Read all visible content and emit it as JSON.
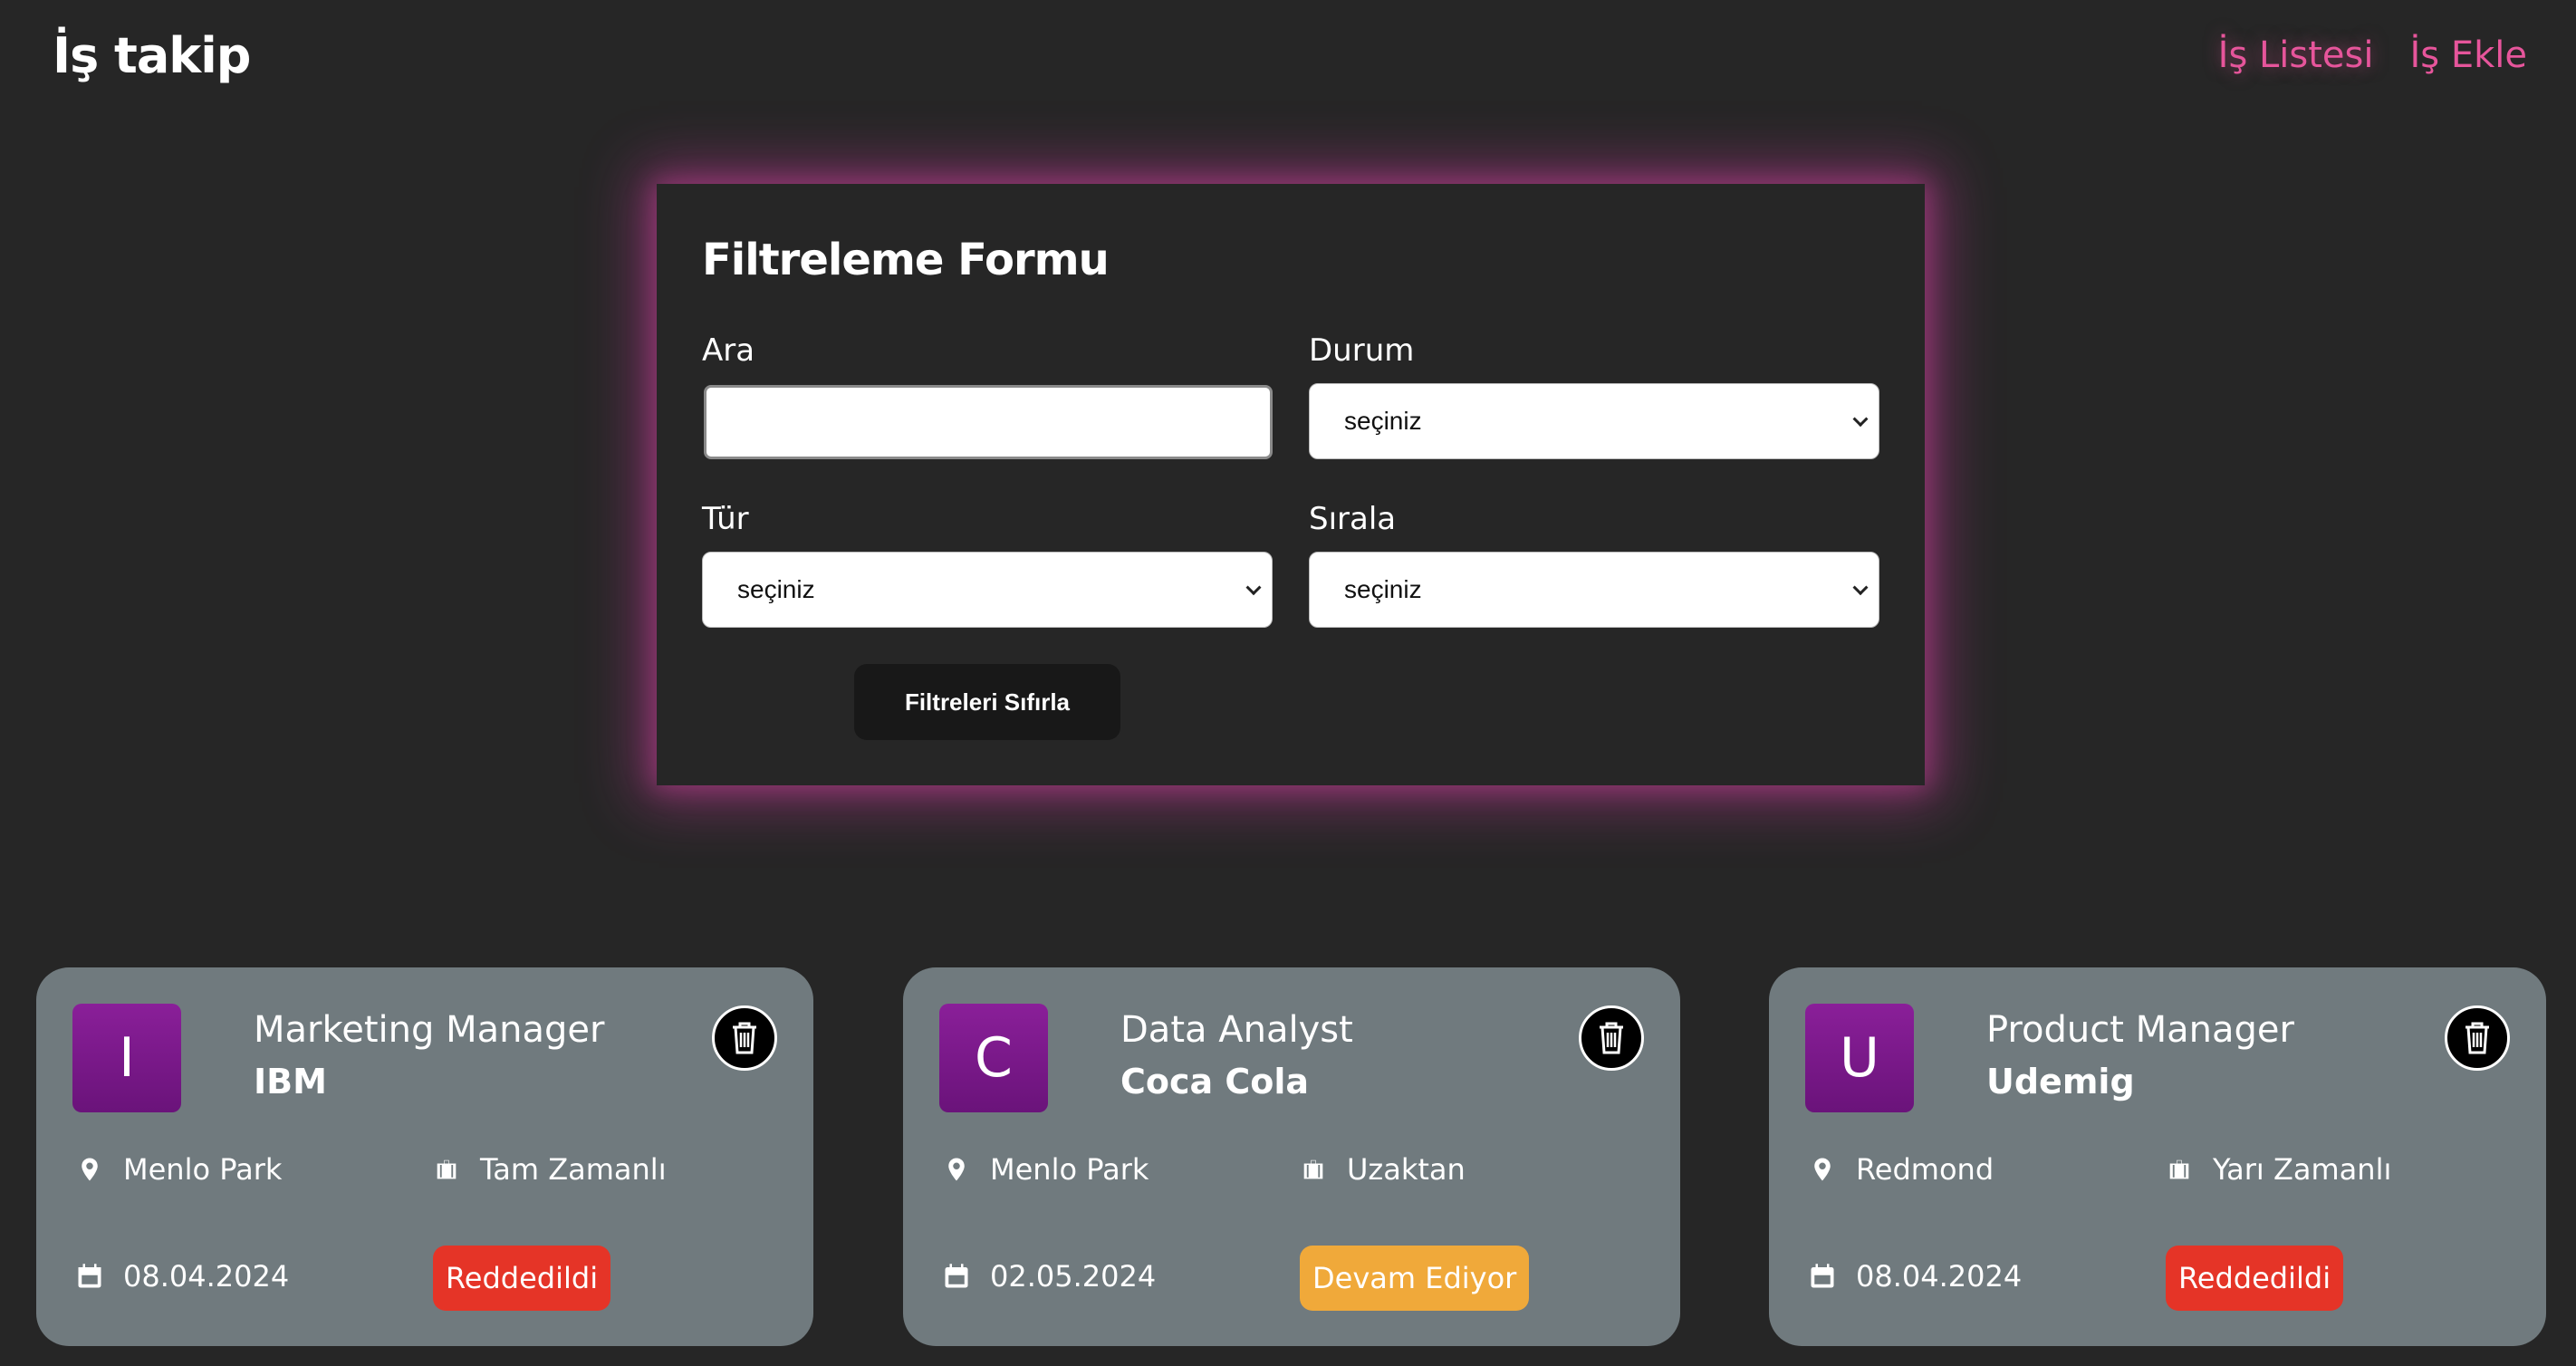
{
  "header": {
    "logo": "İş takip",
    "nav": [
      {
        "label": "İş Listesi"
      },
      {
        "label": "İş Ekle"
      }
    ]
  },
  "filter_form": {
    "title": "Filtreleme Formu",
    "search": {
      "label": "Ara",
      "value": "",
      "placeholder": ""
    },
    "status": {
      "label": "Durum",
      "selected": "seçiniz"
    },
    "type": {
      "label": "Tür",
      "selected": "seçiniz"
    },
    "sort": {
      "label": "Sırala",
      "selected": "seçiniz"
    },
    "reset_label": "Filtreleri Sıfırla"
  },
  "jobs": [
    {
      "initial": "I",
      "position": "Marketing Manager",
      "company": "IBM",
      "location": "Menlo Park",
      "type": "Tam Zamanlı",
      "date": "08.04.2024",
      "status": "Reddedildi",
      "status_color": "#e53427"
    },
    {
      "initial": "C",
      "position": "Data Analyst",
      "company": "Coca Cola",
      "location": "Menlo Park",
      "type": "Uzaktan",
      "date": "02.05.2024",
      "status": "Devam Ediyor",
      "status_color": "#f0a93a"
    },
    {
      "initial": "U",
      "position": "Product Manager",
      "company": "Udemig",
      "location": "Redmond",
      "type": "Yarı Zamanlı",
      "date": "08.04.2024",
      "status": "Reddedildi",
      "status_color": "#e53427"
    }
  ],
  "colors": {
    "background": "#262626",
    "nav_link": "#e6559b",
    "card": "#707a7e",
    "avatar": "#7b1a8a"
  },
  "icons": {
    "location": "map-pin-icon",
    "type": "briefcase-icon",
    "date": "calendar-icon",
    "delete": "trash-icon"
  }
}
